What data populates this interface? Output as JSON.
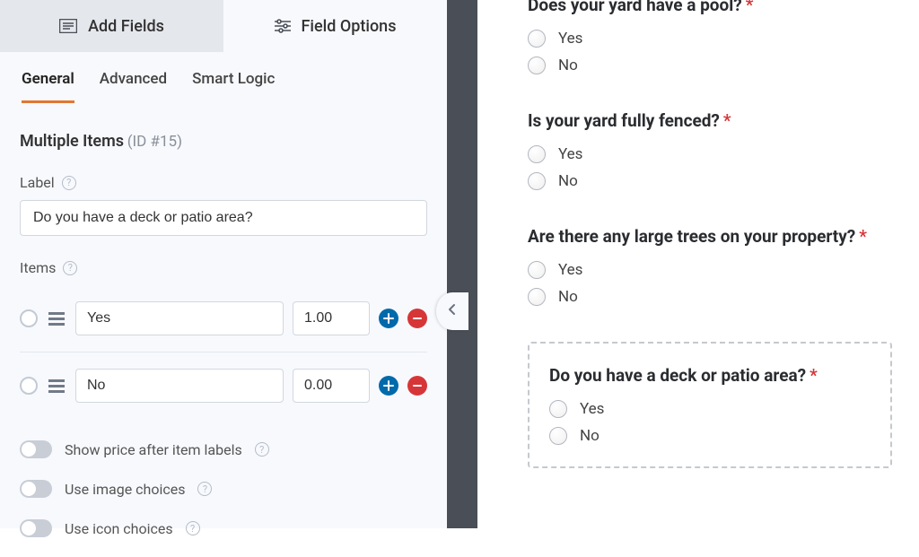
{
  "mainTabs": {
    "addFields": "Add Fields",
    "fieldOptions": "Field Options"
  },
  "subTabs": {
    "general": "General",
    "advanced": "Advanced",
    "smartLogic": "Smart Logic"
  },
  "field": {
    "typeName": "Multiple Items",
    "idText": "(ID #15)",
    "labelCaption": "Label",
    "labelValue": "Do you have a deck or patio area?",
    "itemsCaption": "Items",
    "items": [
      {
        "label": "Yes",
        "price": "1.00"
      },
      {
        "label": "No",
        "price": "0.00"
      }
    ],
    "toggles": {
      "showPrice": "Show price after item labels",
      "imageChoices": "Use image choices",
      "iconChoices": "Use icon choices"
    }
  },
  "preview": {
    "questions": [
      {
        "title": "Does your yard have a pool?",
        "options": [
          "Yes",
          "No"
        ],
        "selected": false
      },
      {
        "title": "Is your yard fully fenced?",
        "options": [
          "Yes",
          "No"
        ],
        "selected": false
      },
      {
        "title": "Are there any large trees on your property?",
        "options": [
          "Yes",
          "No"
        ],
        "selected": false
      },
      {
        "title": "Do you have a deck or patio area?",
        "options": [
          "Yes",
          "No"
        ],
        "selected": true
      }
    ]
  }
}
